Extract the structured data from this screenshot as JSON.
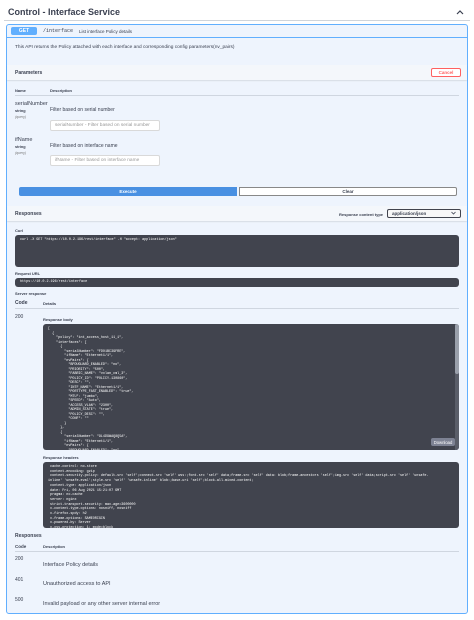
{
  "service": {
    "title": "Control - Interface Service"
  },
  "operation": {
    "method": "GET",
    "path": "/interface",
    "summary": "List interface Policy details",
    "description": "This API returns the Policy attached with each interface and corresponding config parameters(nv_pairs)"
  },
  "parameters": {
    "title": "Parameters",
    "cancel_label": "Cancel",
    "col_name": "Name",
    "col_description": "Description",
    "items": [
      {
        "name": "serialNumber",
        "type": "string",
        "in": "(query)",
        "description": "Filter based on serial number",
        "placeholder": "serialNumber - Filter based on serial number"
      },
      {
        "name": "ifName",
        "type": "string",
        "in": "(query)",
        "description": "Filter based on interface name",
        "placeholder": "ifName - Filter based on interface name"
      }
    ],
    "execute_label": "Execute",
    "clear_label": "Clear"
  },
  "responses_live": {
    "title": "Responses",
    "content_type_label": "Response content type",
    "content_type_value": "application/json",
    "curl_label": "Curl",
    "curl_command": "curl -X GET \"https://10.0.2.196/rest/interface\" -H \"accept: application/json\"",
    "request_url_label": "Request URL",
    "request_url": "https://10.0.2.196/rest/interface",
    "server_response_label": "Server response",
    "col_code": "Code",
    "col_details": "Details",
    "status_code": "200",
    "body_label": "Response body",
    "body_lines": [
      "[",
      "  {",
      "    \"policy\": \"int_access_host_11_1\",",
      "    \"interfaces\": [",
      "      {",
      "        \"serialNumber\": \"FDO1BC39FRE\",",
      "        \"ifName\": \"Ethernet1/1\",",
      "        \"nvPairs\": {",
      "          \"BPDUGUARD_ENABLED\": \"no\",",
      "          \"PRIORITY\": \"500\",",
      "          \"FABRIC_NAME\": \"vxlan_cml_3\",",
      "          \"POLICY_ID\": \"POLICY-130860\",",
      "          \"DESC\": \"\",",
      "          \"INTF_NAME\": \"Ethernet1/1\",",
      "          \"PORTTYPE_FAST_ENABLED\": \"true\",",
      "          \"MTU\": \"jumbo\",",
      "          \"SPEED\": \"Auto\",",
      "          \"ACCESS_VLAN\": \"2300\",",
      "          \"ADMIN_STATE\": \"true\",",
      "          \"POLICY_DESC\": \"\",",
      "          \"CONF\": \"\"",
      "        }",
      "      },",
      "      {",
      "        \"serialNumber\": \"9L4D9WAQ8Q5A\",",
      "        \"ifName\": \"Ethernet1/1\",",
      "        \"nvPairs\": {",
      "          \"BPDUGUARD_ENABLED\": \"no\","
    ],
    "download_label": "Download",
    "headers_label": "Response headers",
    "header_lines": [
      " cache-control: no-store",
      " content-encoding: gzip",
      " content-security-policy: default-src 'self';connect-src 'self' wss:;font-src 'self' data;frame-src 'self' data: blob;frame-ancestors 'self';img-src 'self' data;script-src 'self' 'unsafe-",
      "inline' 'unsafe-eval';style-src 'self' 'unsafe-inline' blob:;base-uri 'self';block-all-mixed-content;",
      " content-type: application/json",
      " date: Fri, 06 Aug 2021 15:21:07 GMT",
      " pragma: no-cache",
      " server: nginx",
      " strict-transport-security: max-age=3600000",
      " x-content-type-options: nosniff, nosniff",
      " x-firefox-spdy: h2",
      " x-frame-options: SAMEORIGIN",
      " x-powered-by: Server",
      " x-xss-protection: 1; mode=block"
    ]
  },
  "responses_doc": {
    "title": "Responses",
    "col_code": "Code",
    "col_description": "Description",
    "rows": [
      {
        "code": "200",
        "description": "Interface Policy details"
      },
      {
        "code": "401",
        "description": "Unauthorized access to API"
      },
      {
        "code": "500",
        "description": "Invalid payload or any other server internal error"
      }
    ]
  },
  "colors": {
    "get": "#61affe",
    "execute": "#4990e2",
    "cancel": "#ff6060",
    "code_bg": "#41444e"
  },
  "icons": {
    "collapse": "chevron-up-icon",
    "select": "chevron-down-icon"
  }
}
